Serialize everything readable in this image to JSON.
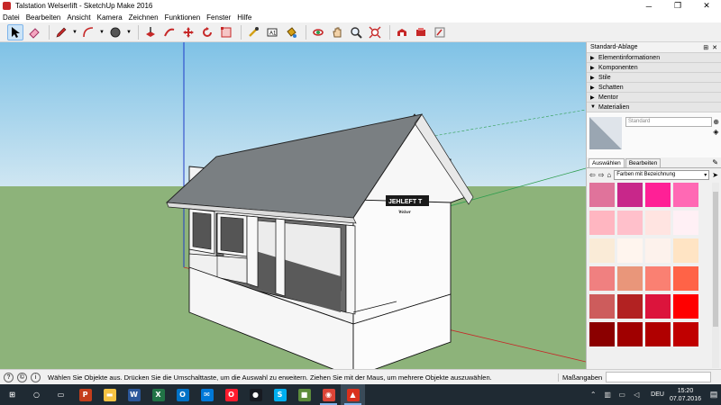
{
  "window": {
    "title": "Talstation Welserlift - SketchUp Make 2016",
    "minimize": "─",
    "maximize": "❐",
    "close": "✕"
  },
  "menu": [
    "Datei",
    "Bearbeiten",
    "Ansicht",
    "Kamera",
    "Zeichnen",
    "Funktionen",
    "Fenster",
    "Hilfe"
  ],
  "toolbar": {
    "tools": [
      "select-tool",
      "eraser-tool",
      "pencil-tool",
      "arc-tool",
      "shapes-tool",
      "push-pull-tool",
      "move-tool",
      "rotate-tool",
      "follow-me-tool",
      "tape-measure-tool",
      "text-tool",
      "paint-bucket-tool",
      "orbit-tool",
      "pan-tool",
      "zoom-tool",
      "zoom-extents-tool",
      "warehouse-tool",
      "extension-tool",
      "layout-tool"
    ]
  },
  "model": {
    "sign_main": "JEHLEFT T",
    "sign_sub": "Welser"
  },
  "tray": {
    "title": "Standard-Ablage",
    "pin": "⊞",
    "close": "✕",
    "panels": [
      "Elementinformationen",
      "Komponenten",
      "Stile",
      "Schatten",
      "Mentor"
    ],
    "materials": {
      "title": "Materialien",
      "name_placeholder": "Standard",
      "tabs": [
        "Auswählen",
        "Bearbeiten"
      ],
      "collection": "Farben mit Bezeichnung",
      "swatch_colors": [
        [
          "#e0739b",
          "#c8278a",
          "#ff2096",
          "#ff69b4"
        ],
        [
          "#ffb6c1",
          "#ffc0cb",
          "#ffe4e1",
          "#fff0f5"
        ],
        [
          "#faebd7",
          "#fff5ee",
          "#fdf2ec",
          "#ffe4c4"
        ],
        [
          "#f08080",
          "#e9967a",
          "#fa8072",
          "#ff6347"
        ],
        [
          "#cd5c5c",
          "#b22222",
          "#dc143c",
          "#ff0000"
        ],
        [
          "#8b0000",
          "#a00000",
          "#b00000",
          "#c00000"
        ]
      ]
    }
  },
  "status": {
    "message": "Wählen Sie Objekte aus. Drücken Sie die Umschalttaste, um die Auswahl zu erweitern. Ziehen Sie mit der Maus, um mehrere Objekte auszuwählen.",
    "measure_label": "Maßangaben"
  },
  "taskbar": {
    "apps": [
      {
        "name": "start",
        "color": "#1f2a33",
        "glyph": "⊞"
      },
      {
        "name": "search",
        "color": "#1f2a33",
        "glyph": "○"
      },
      {
        "name": "task-view",
        "color": "#1f2a33",
        "glyph": "▭"
      },
      {
        "name": "powerpoint",
        "color": "#c43e1c",
        "glyph": "P"
      },
      {
        "name": "explorer",
        "color": "#f6c343",
        "glyph": "▬"
      },
      {
        "name": "word",
        "color": "#2b579a",
        "glyph": "W"
      },
      {
        "name": "excel",
        "color": "#217346",
        "glyph": "X"
      },
      {
        "name": "outlook",
        "color": "#0072c6",
        "glyph": "O"
      },
      {
        "name": "mail",
        "color": "#0078d7",
        "glyph": "✉"
      },
      {
        "name": "opera",
        "color": "#ff1b2d",
        "glyph": "O"
      },
      {
        "name": "steam",
        "color": "#171a21",
        "glyph": "●"
      },
      {
        "name": "skype",
        "color": "#00aff0",
        "glyph": "S"
      },
      {
        "name": "minecraft",
        "color": "#5d8c3b",
        "glyph": "■"
      },
      {
        "name": "chrome",
        "color": "#db4437",
        "glyph": "◉"
      },
      {
        "name": "sketchup",
        "color": "#d9301c",
        "glyph": "▲"
      }
    ],
    "language": "DEU",
    "time": "15:20",
    "date": "07.07.2016"
  },
  "colors": {
    "sky_top": "#7fc2e6",
    "sky_bottom": "#c8e3f0",
    "ground": "#8db37a",
    "roof": "#7a7f82",
    "wall": "#f4f4f4"
  }
}
